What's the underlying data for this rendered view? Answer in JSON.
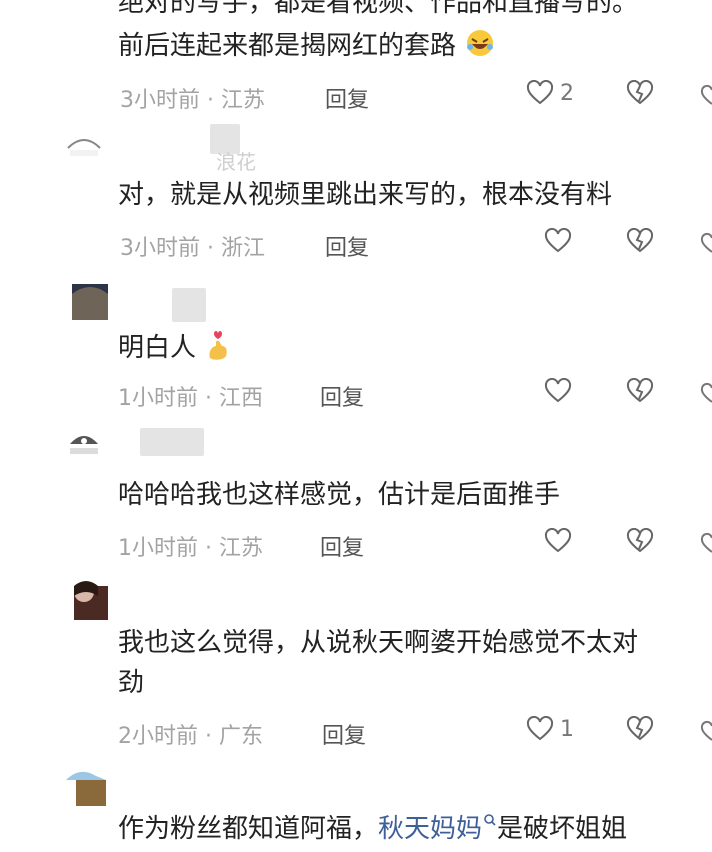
{
  "comments": [
    {
      "text_lines": [
        "绝对的写手，都是看视频、作品和直播写的。",
        "前后连起来都是揭网红的套路"
      ],
      "meta": "3小时前 · 江苏",
      "reply": "回复",
      "likes": "2"
    },
    {
      "user_fragment": "浪花",
      "text_lines": [
        "对，就是从视频里跳出来写的，根本没有料"
      ],
      "meta": "3小时前 · 浙江",
      "reply": "回复",
      "likes": ""
    },
    {
      "text_lines": [
        "明白人"
      ],
      "meta": "1小时前 · 江西",
      "reply": "回复",
      "likes": ""
    },
    {
      "text_lines": [
        "哈哈哈我也这样感觉，估计是后面推手"
      ],
      "meta": "1小时前 · 江苏",
      "reply": "回复",
      "likes": ""
    },
    {
      "text_lines": [
        "我也这么觉得，从说秋天啊婆开始感觉不太对",
        "劲"
      ],
      "meta": "2小时前 · 广东",
      "reply": "回复",
      "likes": "1"
    },
    {
      "text_prefix": "作为粉丝都知道阿福，",
      "text_link": "秋天妈妈",
      "text_suffix": "是破坏姐姐"
    }
  ],
  "icons": {
    "like": "heart-outline-icon",
    "dislike": "broken-heart-icon",
    "laugh_emoji": "rolling-laughing-emoji",
    "finger_heart_emoji": "finger-heart-emoji",
    "search": "search-icon"
  },
  "colors": {
    "text": "#222222",
    "meta": "#a3a3a3",
    "link": "#3f5f99"
  }
}
